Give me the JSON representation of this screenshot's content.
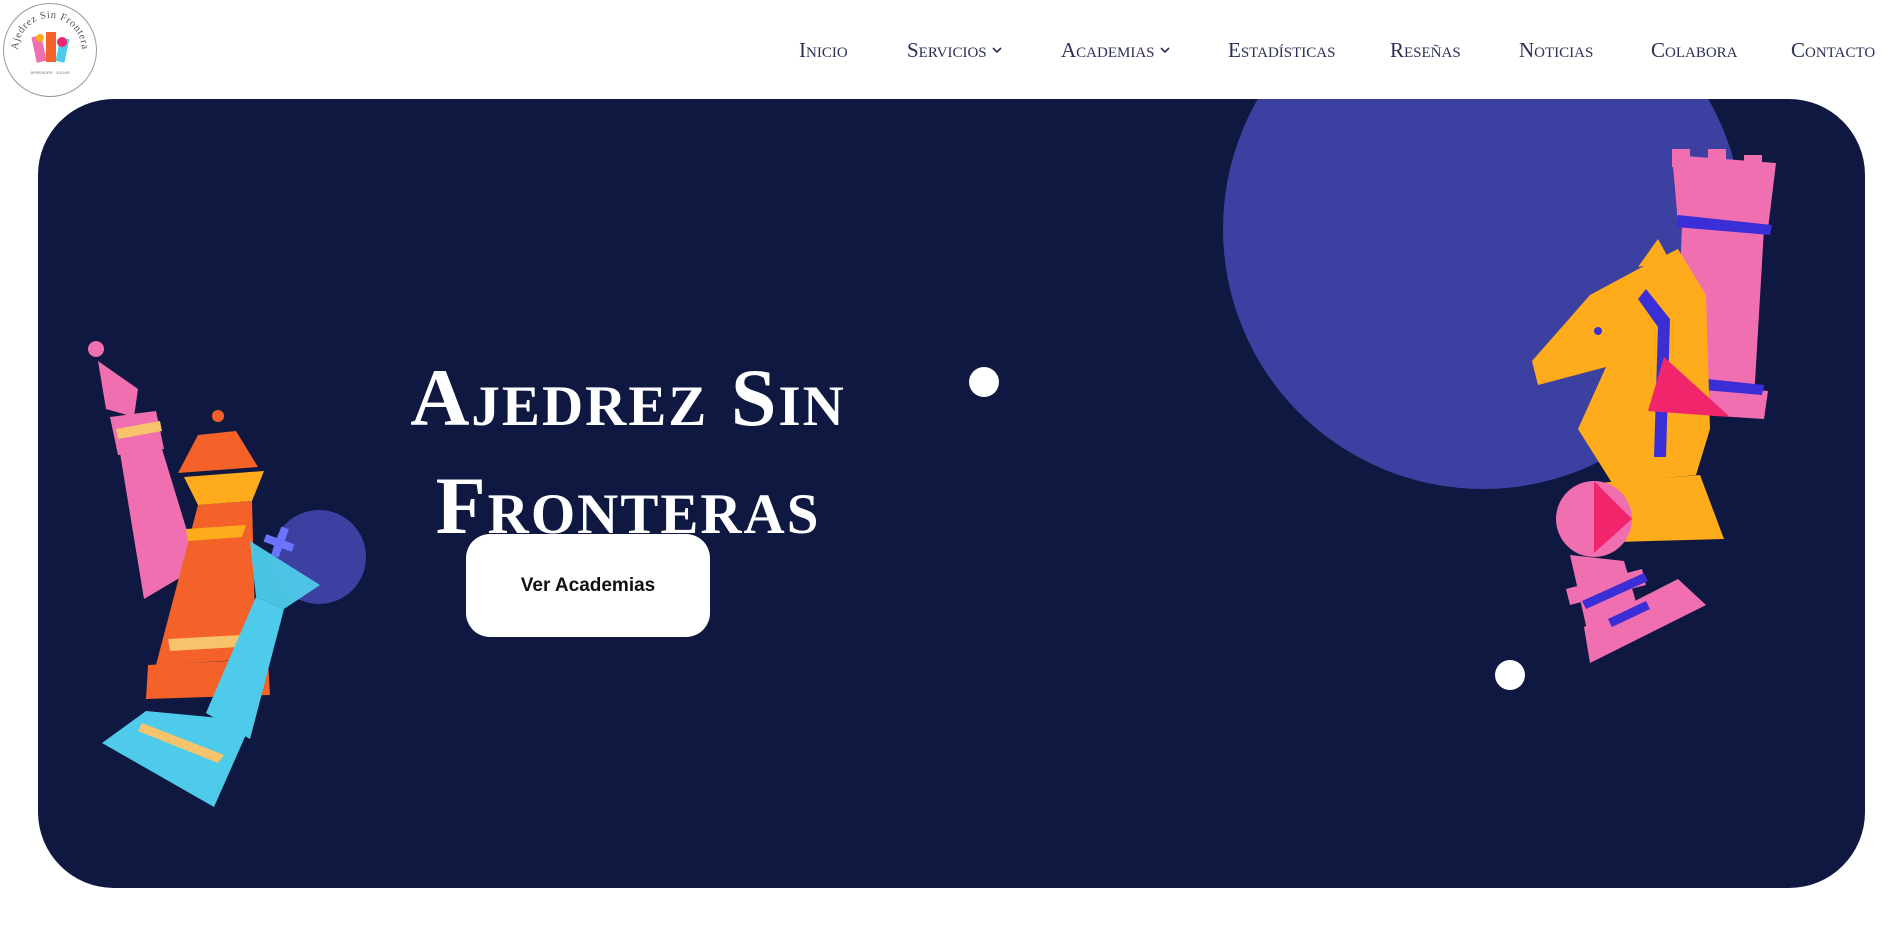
{
  "site": {
    "logo_text": "Ajedrez Sin Fronteras",
    "logo_subtext": "APRENDER · JUGAR"
  },
  "nav": {
    "items": [
      {
        "label": "Inicio",
        "has_dropdown": false
      },
      {
        "label": "Servicios",
        "has_dropdown": true
      },
      {
        "label": "Academias",
        "has_dropdown": true
      },
      {
        "label": "Estadísticas",
        "has_dropdown": false
      },
      {
        "label": "Reseñas",
        "has_dropdown": false
      },
      {
        "label": "Noticias",
        "has_dropdown": false
      },
      {
        "label": "Colabora",
        "has_dropdown": false
      },
      {
        "label": "Contacto",
        "has_dropdown": false
      }
    ]
  },
  "hero": {
    "title_line1": "Ajedrez Sin",
    "title_line2": "Fronteras",
    "cta_label": "Ver Academias"
  },
  "icons": [
    "chevron-down-icon",
    "chess-bishop-icon",
    "chess-queen-icon",
    "chess-king-icon",
    "chess-knight-icon",
    "chess-rook-icon",
    "chess-pawn-icon"
  ],
  "colors": {
    "hero_bg": "#0f1840",
    "nav_text": "#2b2f55",
    "accent_purple": "#3c40a0",
    "pink": "#ef6fb0",
    "orange": "#f4622a",
    "yellow": "#ffac1c",
    "cyan": "#4ecbea",
    "magenta": "#f0256b"
  }
}
